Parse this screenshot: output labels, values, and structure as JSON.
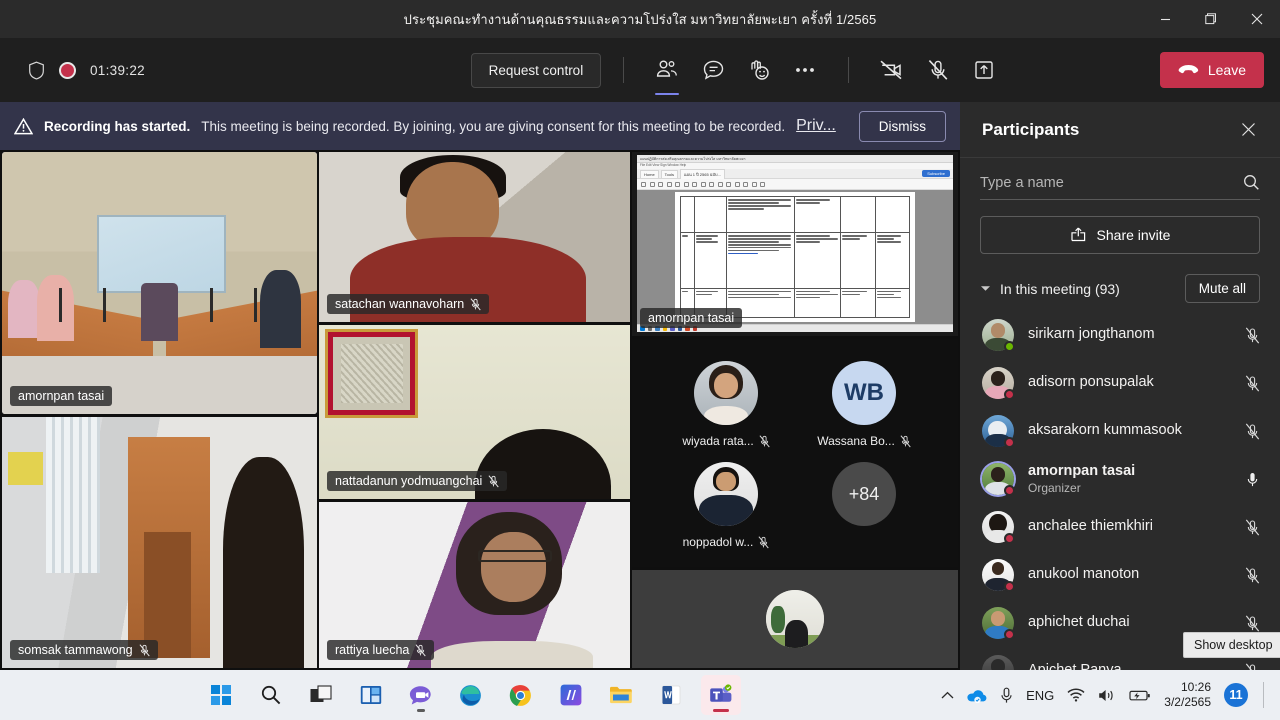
{
  "window": {
    "title": "ประชุมคณะทำงานด้านคุณธรรมและความโปร่งใส มหาวิทยาลัยพะเยา ครั้งที่ 1/2565",
    "minimize_label": "Minimize",
    "restore_label": "Restore",
    "close_label": "Close"
  },
  "toolbar": {
    "timer": "01:39:22",
    "shield_icon": "shield-icon",
    "recording_indicator": "record-dot-icon",
    "request_control_label": "Request control",
    "people_icon": "people-icon",
    "chat_icon": "chat-icon",
    "reactions_icon": "reactions-icon",
    "more_icon": "more-options-icon",
    "camera_icon": "camera-off-icon",
    "mic_icon": "mic-off-icon",
    "share_icon": "share-screen-icon",
    "leave_label": "Leave",
    "leave_icon": "hangup-icon"
  },
  "banner": {
    "warning_icon": "warning-icon",
    "strong": "Recording has started.",
    "text": "This meeting is being recorded. By joining, you are giving consent for this meeting to be recorded.",
    "link": "Priv...",
    "dismiss_label": "Dismiss"
  },
  "stage": {
    "tiles": [
      {
        "name": "amornpan tasai",
        "speaking": true,
        "muted": false
      },
      {
        "name": "somsak tammawong",
        "speaking": false,
        "muted": true
      },
      {
        "name": "satachan wannavoharn",
        "speaking": false,
        "muted": true
      },
      {
        "name": "nattadanun yodmuangchai",
        "speaking": false,
        "muted": true
      },
      {
        "name": "rattiya luecha",
        "speaking": false,
        "muted": true
      }
    ],
    "share": {
      "presenter_name": "amornpan tasai",
      "doc_title": "แผนปฏิบัติการส่งเสริมคุณธรรมและความโปร่งใส มหาวิทยาลัยพะเยา",
      "tab_label": "แผน 1 ปี 2565 ฉบับ...",
      "subscribe_label": "Subscribe"
    },
    "avatars": [
      {
        "name": "wiyada rata...",
        "type": "photo",
        "muted": true
      },
      {
        "name": "Wassana Bo...",
        "type": "initials",
        "initials": "WB",
        "muted": true
      },
      {
        "name": "noppadol w...",
        "type": "photo",
        "muted": true
      },
      {
        "name": "+84",
        "type": "overflow",
        "muted": false
      }
    ]
  },
  "panel": {
    "title": "Participants",
    "close_icon": "close-icon",
    "search_placeholder": "Type a name",
    "search_icon": "search-icon",
    "share_invite_label": "Share invite",
    "share_invite_icon": "share-invite-icon",
    "section_label": "In this meeting (93)",
    "chevron_icon": "chevron-down-icon",
    "mute_all_label": "Mute all",
    "participants": [
      {
        "name": "sirikarn jongthanom",
        "role": "",
        "status": "available",
        "mic": "off",
        "organizer": false
      },
      {
        "name": "adisorn ponsupalak",
        "role": "",
        "status": "busy",
        "mic": "off",
        "organizer": false
      },
      {
        "name": "aksarakorn kummasook",
        "role": "",
        "status": "busy",
        "mic": "off",
        "organizer": false
      },
      {
        "name": "amornpan tasai",
        "role": "Organizer",
        "status": "busy",
        "mic": "on",
        "organizer": true
      },
      {
        "name": "anchalee thiemkhiri",
        "role": "",
        "status": "busy",
        "mic": "off",
        "organizer": false
      },
      {
        "name": "anukool manoton",
        "role": "",
        "status": "busy",
        "mic": "off",
        "organizer": false
      },
      {
        "name": "aphichet duchai",
        "role": "",
        "status": "busy",
        "mic": "off",
        "organizer": false
      },
      {
        "name": "Apichet Panya",
        "role": "",
        "status": "busy",
        "mic": "off",
        "organizer": false
      }
    ]
  },
  "tooltip": {
    "text": "Show desktop"
  },
  "taskbar": {
    "apps": [
      {
        "name": "start-button",
        "label": "Start"
      },
      {
        "name": "search-button",
        "label": "Search"
      },
      {
        "name": "task-view-button",
        "label": "Task view"
      },
      {
        "name": "widgets-button",
        "label": "Widgets"
      },
      {
        "name": "chat-button",
        "label": "Chat"
      },
      {
        "name": "edge-button",
        "label": "Microsoft Edge"
      },
      {
        "name": "chrome-button",
        "label": "Google Chrome"
      },
      {
        "name": "ia-app-button",
        "label": "IA"
      },
      {
        "name": "file-explorer-button",
        "label": "File Explorer"
      },
      {
        "name": "word-button",
        "label": "Word"
      },
      {
        "name": "teams-button",
        "label": "Microsoft Teams"
      }
    ],
    "tray": {
      "overflow_icon": "chevron-up-icon",
      "onedrive_icon": "onedrive-icon",
      "mic_icon": "microphone-icon",
      "language": "ENG",
      "wifi_icon": "wifi-icon",
      "volume_icon": "volume-icon",
      "battery_icon": "battery-charging-icon",
      "time": "10:26",
      "date": "3/2/2565",
      "notification_count": "11"
    }
  }
}
